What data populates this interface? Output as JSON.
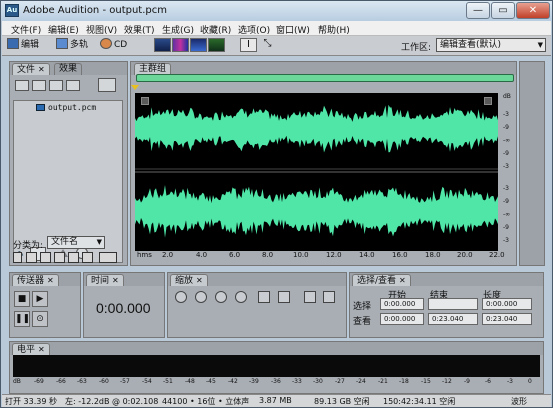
{
  "window": {
    "title": "Adobe Audition - output.pcm",
    "app_icon_text": "Au",
    "controls": [
      "—",
      "▭",
      "✕"
    ]
  },
  "menu": [
    "文件(F)",
    "编辑(E)",
    "视图(V)",
    "效果(T)",
    "生成(G)",
    "收藏(R)",
    "选项(O)",
    "窗口(W)",
    "帮助(H)"
  ],
  "toolbar": {
    "edit_label": "编辑",
    "multitrack_label": "多轨",
    "cd_label": "CD",
    "workspace_label": "工作区:",
    "workspace_value": "编辑查看(默认)"
  },
  "files_panel": {
    "tab_files": "文件",
    "tab_effects": "效果",
    "file_item": "output.pcm",
    "sort_label": "分类为:",
    "sort_value": "文件名"
  },
  "main_panel": {
    "tab_label": "主群组",
    "db_label": "dB",
    "db_ticks_top": [
      "dB",
      "-3",
      "-9",
      "-∞",
      "-9",
      "-3"
    ],
    "db_ticks_bottom": [
      "-3",
      "-9",
      "-∞",
      "-9",
      "-3"
    ],
    "time_unit": "hms",
    "time_ticks": [
      "2.0",
      "4.0",
      "6.0",
      "8.0",
      "10.0",
      "12.0",
      "14.0",
      "16.0",
      "18.0",
      "20.0",
      "22.0"
    ],
    "wave_color": "#4fe6a8"
  },
  "transport_panel": {
    "tab_label": "传送器"
  },
  "time_panel": {
    "tab_label": "时间",
    "time_value": "0:00.000"
  },
  "zoom_panel": {
    "tab_label": "缩放"
  },
  "selection_panel": {
    "tab_label": "选择/查看",
    "col_start": "开始",
    "col_end": "结束",
    "col_length": "长度",
    "row_selection": "选择",
    "row_view": "查看",
    "sel_start": "0:00.000",
    "sel_end": "",
    "sel_length": "0:00.000",
    "view_start": "0:00.000",
    "view_end": "0:23.040",
    "view_length": "0:23.040"
  },
  "level_panel": {
    "tab_label": "电平",
    "scale": [
      "dB",
      "-69",
      "-66",
      "-63",
      "-60",
      "-57",
      "-54",
      "-51",
      "-48",
      "-45",
      "-42",
      "-39",
      "-36",
      "-33",
      "-30",
      "-27",
      "-24",
      "-21",
      "-18",
      "-15",
      "-12",
      "-9",
      "-6",
      "-3",
      "0"
    ]
  },
  "status": {
    "open": "打开 33.39 秒",
    "left": "左: -12.2dB @ 0:02.108",
    "format": "44100 • 16位 • 立体声",
    "size": "3.87 MB",
    "space": "89.13 GB 空闲",
    "free_time": "150:42:34.11 空闲",
    "mode": "波形"
  }
}
